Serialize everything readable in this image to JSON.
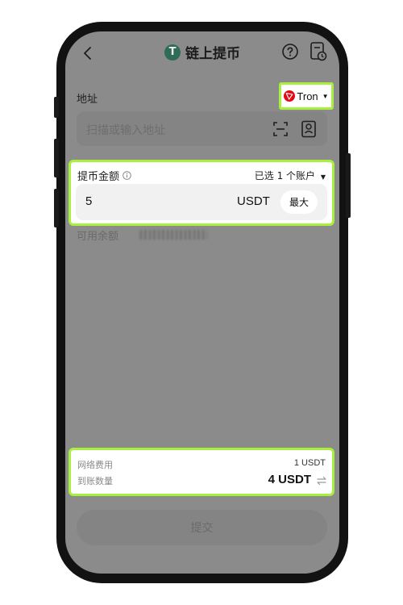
{
  "header": {
    "title": "链上提币",
    "coin_icon_glyph": "T"
  },
  "address": {
    "label": "地址",
    "network": "Tron",
    "placeholder": "扫描或输入地址"
  },
  "amount": {
    "label": "提币金额",
    "account_select": "已选 1 个账户",
    "value": "5",
    "unit": "USDT",
    "max_label": "最大"
  },
  "balance": {
    "label": "可用余额"
  },
  "fees": {
    "network_fee_label": "网络费用",
    "network_fee_value": "1 USDT",
    "receive_label": "到账数量",
    "receive_value": "4 USDT"
  },
  "submit": {
    "label": "提交"
  },
  "colors": {
    "highlight": "#a7f13e",
    "tron_red": "#e50914",
    "usdt_green": "#2f6b56"
  },
  "icons": [
    "back-icon",
    "usdt-icon",
    "help-icon",
    "history-icon",
    "tron-icon",
    "scan-icon",
    "contact-icon",
    "info-icon",
    "swap-icon"
  ]
}
